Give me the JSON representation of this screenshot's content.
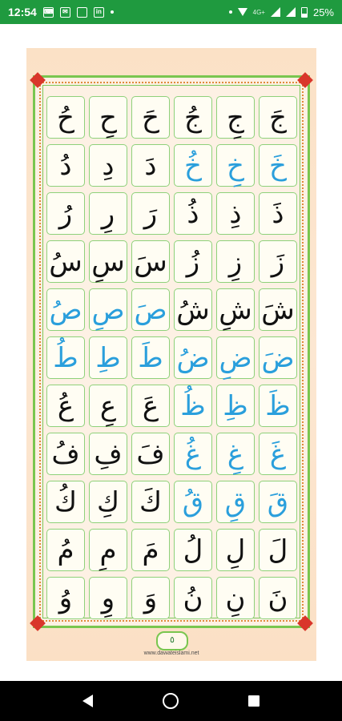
{
  "status_bar": {
    "time": "12:54",
    "notification_icons": [
      "kbd-icon",
      "msg-icon",
      "file-icon",
      "linkedin-icon"
    ],
    "network_label": "4G+",
    "battery": "25%"
  },
  "page": {
    "page_number": "٥",
    "website": "www.dawateislami.net",
    "rows": [
      [
        {
          "t": "حُ",
          "c": "black"
        },
        {
          "t": "حِ",
          "c": "black"
        },
        {
          "t": "حَ",
          "c": "black"
        },
        {
          "t": "جُ",
          "c": "black"
        },
        {
          "t": "جِ",
          "c": "black"
        },
        {
          "t": "جَ",
          "c": "black"
        }
      ],
      [
        {
          "t": "دُ",
          "c": "black"
        },
        {
          "t": "دِ",
          "c": "black"
        },
        {
          "t": "دَ",
          "c": "black"
        },
        {
          "t": "خُ",
          "c": "blue"
        },
        {
          "t": "خِ",
          "c": "blue"
        },
        {
          "t": "خَ",
          "c": "blue"
        }
      ],
      [
        {
          "t": "رُ",
          "c": "black"
        },
        {
          "t": "رِ",
          "c": "black"
        },
        {
          "t": "رَ",
          "c": "black"
        },
        {
          "t": "ذُ",
          "c": "black"
        },
        {
          "t": "ذِ",
          "c": "black"
        },
        {
          "t": "ذَ",
          "c": "black"
        }
      ],
      [
        {
          "t": "سُ",
          "c": "black"
        },
        {
          "t": "سِ",
          "c": "black"
        },
        {
          "t": "سَ",
          "c": "black"
        },
        {
          "t": "زُ",
          "c": "black"
        },
        {
          "t": "زِ",
          "c": "black"
        },
        {
          "t": "زَ",
          "c": "black"
        }
      ],
      [
        {
          "t": "صُ",
          "c": "blue"
        },
        {
          "t": "صِ",
          "c": "blue"
        },
        {
          "t": "صَ",
          "c": "blue"
        },
        {
          "t": "شُ",
          "c": "black"
        },
        {
          "t": "شِ",
          "c": "black"
        },
        {
          "t": "شَ",
          "c": "black"
        }
      ],
      [
        {
          "t": "طُ",
          "c": "blue"
        },
        {
          "t": "طِ",
          "c": "blue"
        },
        {
          "t": "طَ",
          "c": "blue"
        },
        {
          "t": "ضُ",
          "c": "blue"
        },
        {
          "t": "ضِ",
          "c": "blue"
        },
        {
          "t": "ضَ",
          "c": "blue"
        }
      ],
      [
        {
          "t": "عُ",
          "c": "black"
        },
        {
          "t": "عِ",
          "c": "black"
        },
        {
          "t": "عَ",
          "c": "black"
        },
        {
          "t": "ظُ",
          "c": "blue"
        },
        {
          "t": "ظِ",
          "c": "blue"
        },
        {
          "t": "ظَ",
          "c": "blue"
        }
      ],
      [
        {
          "t": "فُ",
          "c": "black"
        },
        {
          "t": "فِ",
          "c": "black"
        },
        {
          "t": "فَ",
          "c": "black"
        },
        {
          "t": "غُ",
          "c": "blue"
        },
        {
          "t": "غِ",
          "c": "blue"
        },
        {
          "t": "غَ",
          "c": "blue"
        }
      ],
      [
        {
          "t": "كُ",
          "c": "black"
        },
        {
          "t": "كِ",
          "c": "black"
        },
        {
          "t": "كَ",
          "c": "black"
        },
        {
          "t": "قُ",
          "c": "blue"
        },
        {
          "t": "قِ",
          "c": "blue"
        },
        {
          "t": "قَ",
          "c": "blue"
        }
      ],
      [
        {
          "t": "مُ",
          "c": "black"
        },
        {
          "t": "مِ",
          "c": "black"
        },
        {
          "t": "مَ",
          "c": "black"
        },
        {
          "t": "لُ",
          "c": "black"
        },
        {
          "t": "لِ",
          "c": "black"
        },
        {
          "t": "لَ",
          "c": "black"
        }
      ],
      [
        {
          "t": "وُ",
          "c": "black"
        },
        {
          "t": "وِ",
          "c": "black"
        },
        {
          "t": "وَ",
          "c": "black"
        },
        {
          "t": "نُ",
          "c": "black"
        },
        {
          "t": "نِ",
          "c": "black"
        },
        {
          "t": "نَ",
          "c": "black"
        }
      ]
    ]
  },
  "nav_bar": {
    "buttons": [
      "back-button",
      "home-button",
      "recents-button"
    ]
  }
}
